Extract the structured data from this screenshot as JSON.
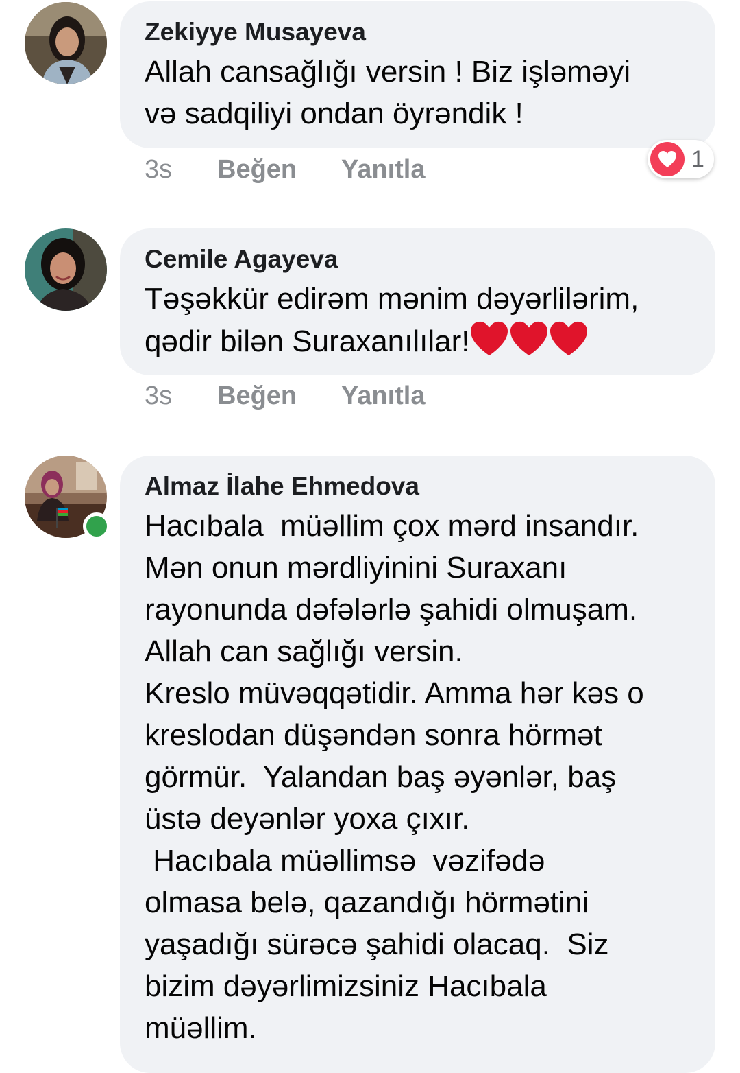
{
  "comments": [
    {
      "author": "Zekiyye Musayeva",
      "text": "Allah cansağlığı versin ! Biz işləməyi\nvə sadqiliyi ondan öyrəndik !",
      "time": "3s",
      "like": "Beğen",
      "reply": "Yanıtla",
      "reaction_count": "1",
      "reaction_icon": "heart-icon",
      "online": false
    },
    {
      "author": "Cemile Agayeva",
      "text": "Təşəkkür edirəm mənim dəyərlilərim,\nqədir bilən Suraxanılılar!",
      "emoji_suffix": [
        "red-heart-emoji",
        "red-heart-emoji",
        "red-heart-emoji"
      ],
      "time": "3s",
      "like": "Beğen",
      "reply": "Yanıtla",
      "online": false
    },
    {
      "author": "Almaz İlahe Ehmedova",
      "text": "Hacıbala  müəllim çox mərd insandır.\nMən onun mərdliyinini Suraxanı\nrayonunda dəfələrlə şahidi olmuşam.\nAllah can sağlığı versin.\nKreslo müvəqqətidir. Amma hər kəs o\nkreslodan düşəndən sonra hörmət\ngörmür.  Yalandan baş əyənlər, baş\nüstə deyənlər yoxa çıxır.\n Hacıbala müəllimsə  vəzifədə\nolmasa belə, qazandığı hörmətini\nyaşadığı sürəcə şahidi olacaq.  Siz\nbizim dəyərlimizsiniz Hacıbala\nmüəllim.",
      "online": true
    }
  ],
  "colors": {
    "bubble": "#f0f2f5",
    "meta": "#8a8d91",
    "online": "#31a24c",
    "heart": "#f33e58"
  }
}
